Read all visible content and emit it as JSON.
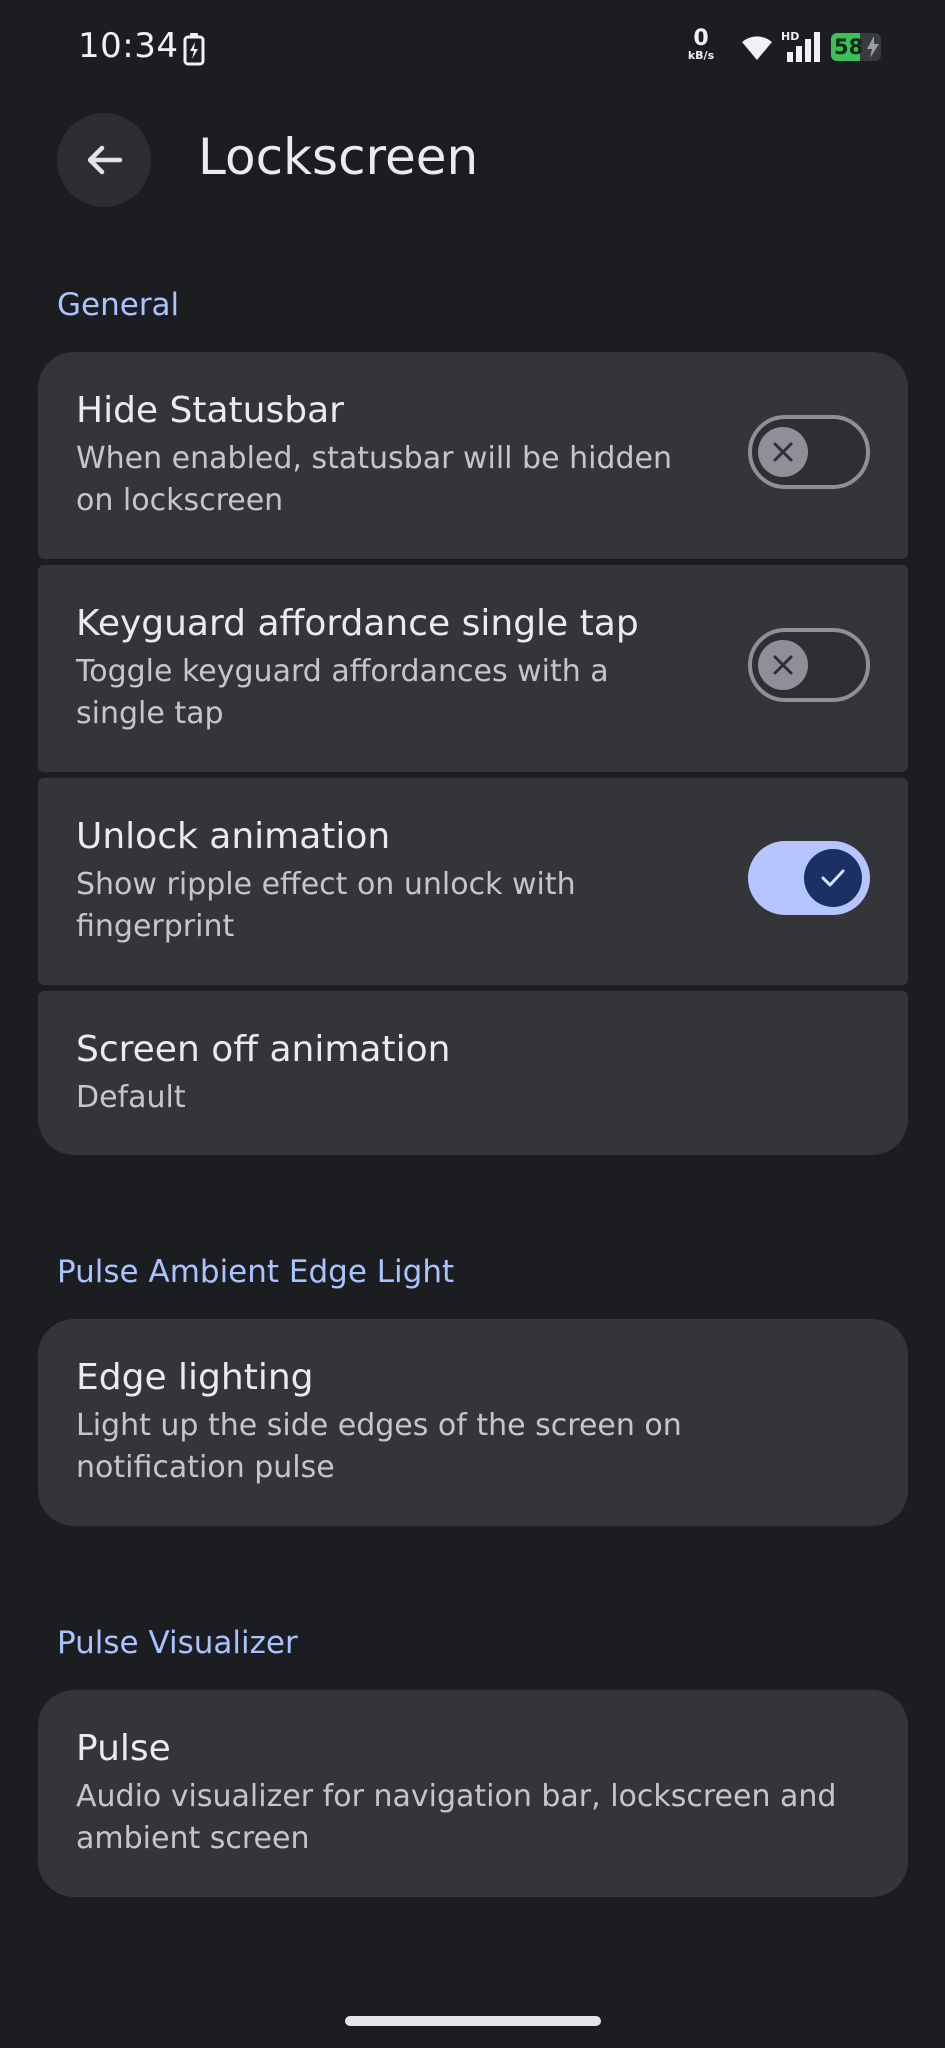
{
  "status_bar": {
    "time": "10:34",
    "net_speed": "0",
    "net_unit": "kB/s",
    "network_type": "HD",
    "battery_level": "58",
    "battery_fraction": 0.58,
    "battery_color": "#3fbf5a"
  },
  "app_bar": {
    "back_icon": "arrow-back-icon",
    "title": "Lockscreen"
  },
  "sections": {
    "general": {
      "header": "General",
      "items": [
        {
          "title": "Hide Statusbar",
          "subtitle": "When enabled, statusbar will be hidden on lockscreen",
          "toggle": false
        },
        {
          "title": "Keyguard affordance single tap",
          "subtitle": "Toggle keyguard affordances with a single tap",
          "toggle": false
        },
        {
          "title": "Unlock animation",
          "subtitle": "Show ripple effect on unlock with fingerprint",
          "toggle": true
        },
        {
          "title": "Screen off animation",
          "subtitle": "Default"
        }
      ]
    },
    "pulse_edge": {
      "header": "Pulse Ambient Edge Light",
      "items": [
        {
          "title": "Edge lighting",
          "subtitle": "Light up the side edges of the screen on notification pulse"
        }
      ]
    },
    "pulse_visualizer": {
      "header": "Pulse Visualizer",
      "items": [
        {
          "title": "Pulse",
          "subtitle": "Audio visualizer for navigation bar, lockscreen and ambient screen"
        }
      ]
    }
  },
  "colors": {
    "background": "#1c1d21",
    "card": "#343539",
    "accent": "#a9c3ff",
    "switch_on_track": "#b6c5ff",
    "switch_on_thumb": "#1b3065"
  }
}
